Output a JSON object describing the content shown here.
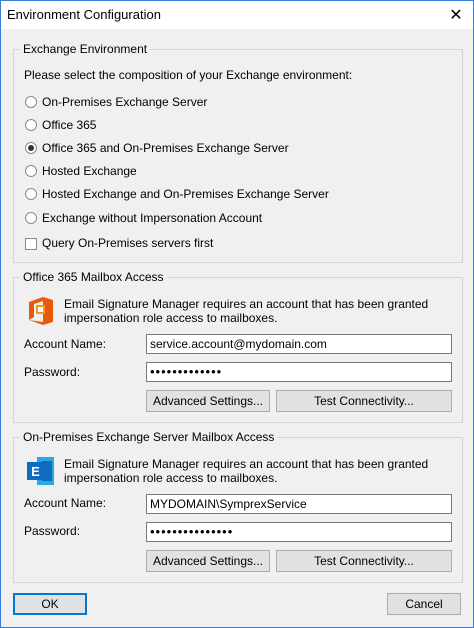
{
  "window": {
    "title": "Environment Configuration",
    "close_glyph": "✕"
  },
  "exchange_env": {
    "legend": "Exchange Environment",
    "prompt": "Please select the composition of your Exchange environment:",
    "options": [
      {
        "label": "On-Premises Exchange Server",
        "selected": false
      },
      {
        "label": "Office 365",
        "selected": false
      },
      {
        "label": "Office 365 and On-Premises Exchange Server",
        "selected": true
      },
      {
        "label": "Hosted Exchange",
        "selected": false
      },
      {
        "label": "Hosted Exchange and On-Premises Exchange Server",
        "selected": false
      },
      {
        "label": "Exchange without Impersonation Account",
        "selected": false
      }
    ],
    "query_checkbox": {
      "label": "Query On-Premises servers first",
      "checked": false
    }
  },
  "o365": {
    "legend": "Office 365 Mailbox Access",
    "icon": "office365-icon",
    "description_line1": "Email Signature Manager requires an account that has been granted",
    "description_line2": "impersonation role access to mailboxes.",
    "account_label": "Account Name:",
    "account_value": "service.account@mydomain.com",
    "password_label": "Password:",
    "password_value": "•••••••••••••",
    "advanced_label": "Advanced Settings...",
    "test_label": "Test Connectivity..."
  },
  "onprem": {
    "legend": "On-Premises Exchange Server Mailbox Access",
    "icon": "exchange-icon",
    "description_line1": "Email Signature Manager requires an account that has been granted",
    "description_line2": "impersonation role access to mailboxes.",
    "account_label": "Account Name:",
    "account_value": "MYDOMAIN\\SymprexService",
    "password_label": "Password:",
    "password_value": "•••••••••••••••",
    "advanced_label": "Advanced Settings...",
    "test_label": "Test Connectivity..."
  },
  "footer": {
    "ok_label": "OK",
    "cancel_label": "Cancel"
  },
  "colors": {
    "accent": "#0078d7",
    "office_orange": "#e8590c",
    "exchange_blue": "#0f6cbd"
  }
}
